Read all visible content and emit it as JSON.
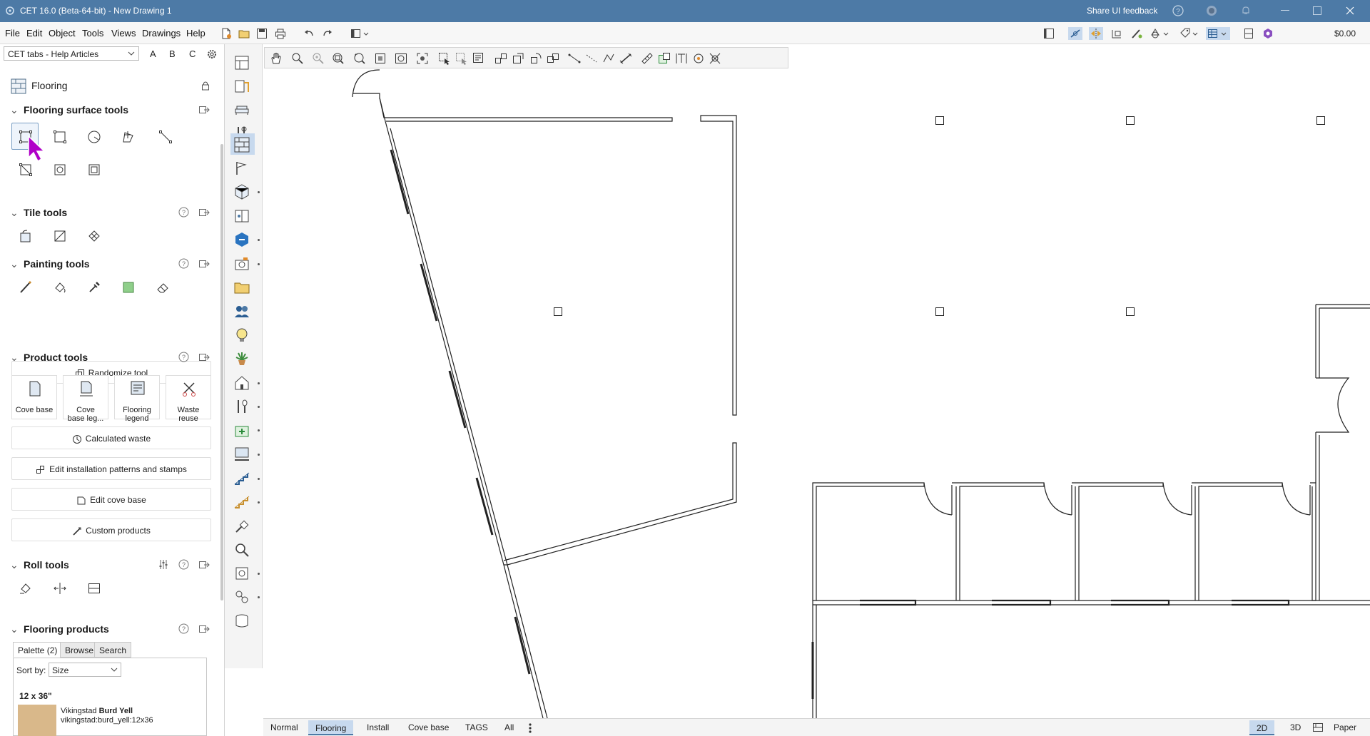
{
  "titlebar": {
    "title": "CET 16.0 (Beta-64-bit) - New Drawing 1",
    "feedback": "Share UI feedback"
  },
  "menubar": {
    "items": [
      "File",
      "Edit",
      "Object",
      "Tools",
      "Views",
      "Drawings",
      "Help"
    ],
    "price": "$0.00"
  },
  "left_panel": {
    "tab_selector": "CET tabs - Help Articles",
    "tab_buttons": [
      "A",
      "B",
      "C"
    ],
    "header": "Flooring",
    "sections": {
      "surface": "Flooring surface tools",
      "tile": "Tile tools",
      "painting": "Painting tools",
      "product": "Product tools",
      "roll": "Roll tools",
      "products": "Flooring products"
    },
    "buttons": {
      "randomize": "Randomize tool",
      "waste": "Calculated waste",
      "patterns": "Edit installation patterns and stamps",
      "cove": "Edit cove base",
      "custom": "Custom products"
    },
    "product_tiles": [
      {
        "line1": "Cove base",
        "line2": ""
      },
      {
        "line1": "Cove",
        "line2": "base leg..."
      },
      {
        "line1": "Flooring",
        "line2": "legend"
      },
      {
        "line1": "Waste",
        "line2": "reuse"
      }
    ],
    "product_tabs": [
      "Palette (2)",
      "Browse",
      "Search"
    ],
    "sort_label": "Sort by:",
    "sort_value": "Size",
    "size_group": "12 x 36\"",
    "product_name_prefix": "Vikingstad ",
    "product_name_bold": "Burd Yell",
    "product_code": "vikingstad:burd_yell:12x36"
  },
  "bottom_bar": {
    "tabs": [
      "Normal",
      "Flooring",
      "Install",
      "Cove base",
      "TAGS",
      "All"
    ],
    "active_tab": "Flooring",
    "view_buttons": [
      "2D",
      "3D",
      "Paper"
    ]
  },
  "colors": {
    "titlebar": "#4d7aa6",
    "selection": "#c7d9ee",
    "cursor": "#b000c8"
  }
}
